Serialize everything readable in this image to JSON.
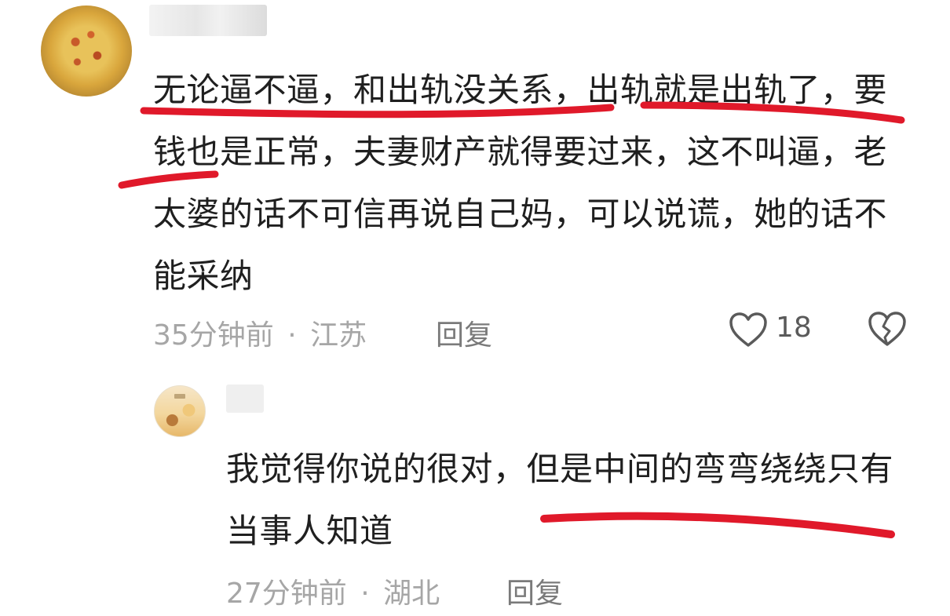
{
  "comment": {
    "text": "无论逼不逼，和出轨没关系，出轨就是出轨了，要钱也是正常，夫妻财产就得要过来，这不叫逼，老太婆的话不可信再说自己妈，可以说谎，她的话不能采纳",
    "time": "35分钟前",
    "separator": "·",
    "location": "江苏",
    "reply_label": "回复",
    "like_count": "18",
    "icons": {
      "like": "heart-outline-icon",
      "dislike": "broken-heart-icon"
    }
  },
  "reply": {
    "text": "我觉得你说的很对，但是中间的弯弯绕绕只有当事人知道",
    "time": "27分钟前",
    "separator": "·",
    "location": "湖北",
    "reply_label": "回复"
  },
  "colors": {
    "annotation_stroke": "#e0192a",
    "meta_text": "#a6a6a6",
    "body_text": "#1f1f1f"
  }
}
